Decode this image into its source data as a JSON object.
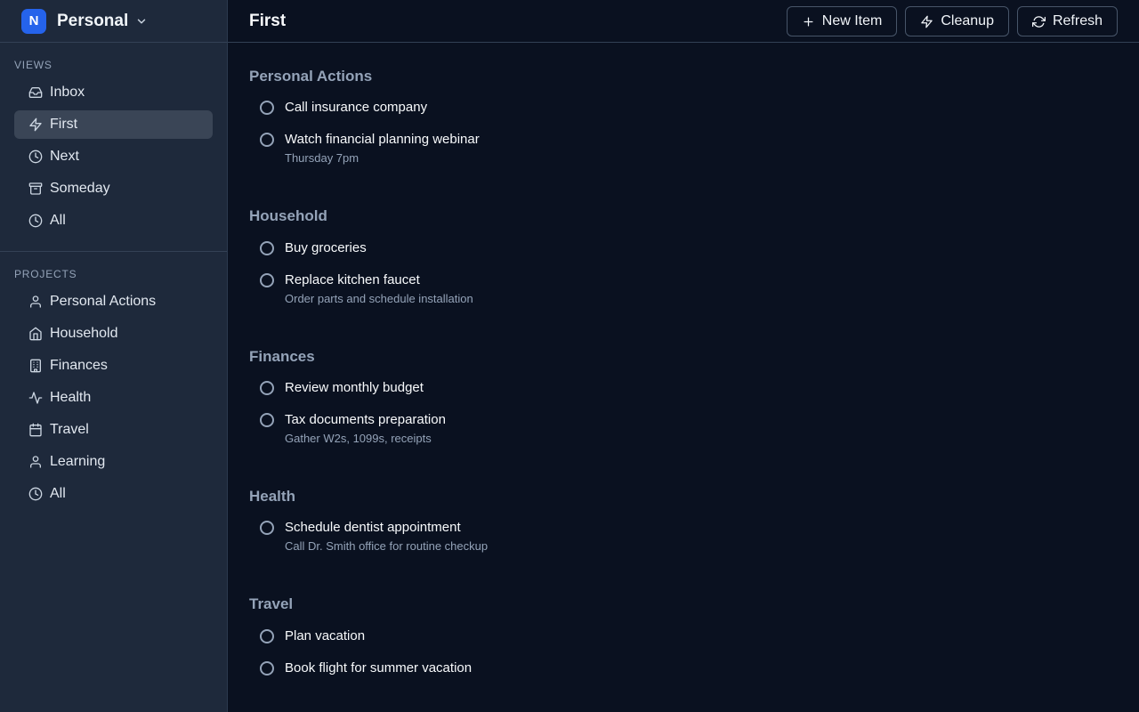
{
  "workspace": {
    "initial": "N",
    "name": "Personal"
  },
  "sidebar": {
    "views_label": "VIEWS",
    "views": [
      {
        "label": "Inbox",
        "icon": "inbox-icon"
      },
      {
        "label": "First",
        "icon": "lightning-icon",
        "active": true
      },
      {
        "label": "Next",
        "icon": "clock-icon"
      },
      {
        "label": "Someday",
        "icon": "archive-icon"
      },
      {
        "label": "All",
        "icon": "clock-icon"
      }
    ],
    "projects_label": "PROJECTS",
    "projects": [
      {
        "label": "Personal Actions",
        "icon": "user-icon"
      },
      {
        "label": "Household",
        "icon": "home-icon"
      },
      {
        "label": "Finances",
        "icon": "building-icon"
      },
      {
        "label": "Health",
        "icon": "activity-icon"
      },
      {
        "label": "Travel",
        "icon": "calendar-icon"
      },
      {
        "label": "Learning",
        "icon": "user-icon"
      },
      {
        "label": "All",
        "icon": "clock-icon"
      }
    ]
  },
  "header": {
    "title": "First",
    "new_item_label": "New Item",
    "cleanup_label": "Cleanup",
    "refresh_label": "Refresh"
  },
  "groups": [
    {
      "title": "Personal Actions",
      "tasks": [
        {
          "title": "Call insurance company",
          "note": ""
        },
        {
          "title": "Watch financial planning webinar",
          "note": "Thursday 7pm"
        }
      ]
    },
    {
      "title": "Household",
      "tasks": [
        {
          "title": "Buy groceries",
          "note": ""
        },
        {
          "title": "Replace kitchen faucet",
          "note": "Order parts and schedule installation"
        }
      ]
    },
    {
      "title": "Finances",
      "tasks": [
        {
          "title": "Review monthly budget",
          "note": ""
        },
        {
          "title": "Tax documents preparation",
          "note": "Gather W2s, 1099s, receipts"
        }
      ]
    },
    {
      "title": "Health",
      "tasks": [
        {
          "title": "Schedule dentist appointment",
          "note": "Call Dr. Smith office for routine checkup"
        }
      ]
    },
    {
      "title": "Travel",
      "tasks": [
        {
          "title": "Plan vacation",
          "note": ""
        },
        {
          "title": "Book flight for summer vacation",
          "note": ""
        }
      ]
    }
  ],
  "colors": {
    "background": "#0a1120",
    "sidebar": "#1e293b",
    "accent": "#2563eb",
    "active_nav": "#3a4556",
    "muted_text": "#94a3b8"
  }
}
